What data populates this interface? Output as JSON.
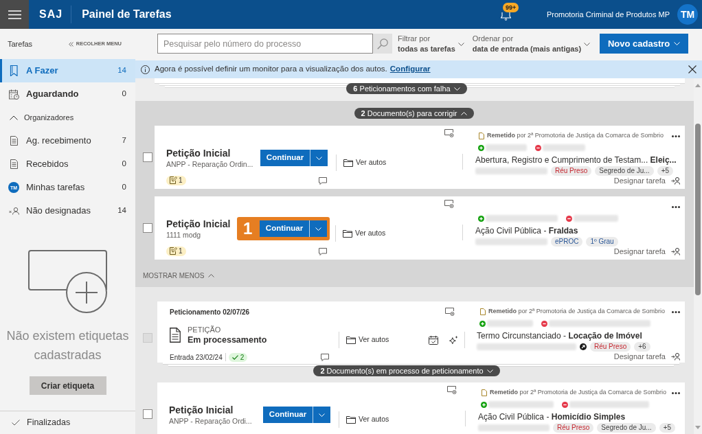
{
  "topbar": {
    "logo": "SAJ",
    "title": "Painel de Tarefas",
    "notification_count": "99+",
    "organization": "Promotoria Criminal de Produtos MP",
    "avatar_initials": "TM"
  },
  "sidebar": {
    "heading": "Tarefas",
    "collapse_label": "RECOLHER MENU",
    "items": [
      {
        "kind": "icon",
        "label": "A Fazer",
        "count": "14",
        "selected": true
      },
      {
        "kind": "icon",
        "label": "Aguardando",
        "count": "0",
        "selected": false
      }
    ],
    "organizers": {
      "label": "Organizadores",
      "expanded": true,
      "items": [
        {
          "kind": "icon",
          "label": "Ag. recebimento",
          "count": "7",
          "selected": false
        },
        {
          "kind": "icon",
          "label": "Recebidos",
          "count": "0",
          "selected": false
        },
        {
          "kind": "avatar",
          "initials": "TM",
          "label": "Minhas tarefas",
          "count": "0",
          "selected": false
        },
        {
          "kind": "icon",
          "label": "Não designadas",
          "count": "14",
          "selected": false
        }
      ]
    },
    "empty_labels": {
      "message": "Não existem etiquetas cadastradas",
      "button": "Criar etiqueta"
    },
    "footer_item": {
      "label": "Finalizadas"
    }
  },
  "toolbar": {
    "search": {
      "placeholder": "Pesquisar pelo número do processo"
    },
    "filter": {
      "label": "Filtrar por",
      "value": "todas as tarefas"
    },
    "sort": {
      "label": "Ordenar por",
      "value": "data de entrada (mais antigas)"
    },
    "new_button": "Novo cadastro"
  },
  "banner": {
    "message": "Agora é possível definir um monitor para a visualização dos autos.",
    "link": "Configurar"
  },
  "task_list": {
    "failed_group": {
      "label": "**6** Peticionamentos com falha",
      "expanded": false
    },
    "correction_group": {
      "label": "**2** Documento(s) para corrigir",
      "expanded": true,
      "collapse_label": "MOSTRAR MENOS",
      "cards": [
        {
          "kind": "task",
          "checked": false,
          "disabled": false,
          "title": "Petição Inicial",
          "subtitle": "ANPP - Reparação Ordin...",
          "action": "Continuar",
          "link": "Ver autos",
          "note_count": "1",
          "sender": "**Remetido** por 2ª Promotoria de Justiça da Comarca de Sombrio",
          "subject": "Abertura, Registro e Cumprimento de Testam... **Eleiç...**",
          "tags": [
            {
              "kind": "text",
              "label": "Réu Preso",
              "color": "#c4262e"
            },
            {
              "kind": "text",
              "label": "Segredo de Ju...",
              "color": "#424242"
            },
            {
              "kind": "text",
              "label": "+5",
              "color": "#424242"
            }
          ],
          "assign": "Designar tarefa"
        },
        {
          "kind": "task",
          "checked": false,
          "disabled": false,
          "title": "Petição Inicial",
          "subtitle": "1111 modg",
          "action": "Continuar",
          "callout": "1",
          "link": "Ver autos",
          "note_count": "1",
          "subject": "Ação Civil Pública - **Fraldas**",
          "tags": [
            {
              "kind": "text",
              "label": "ePROC",
              "color": "#2b5797"
            },
            {
              "kind": "text",
              "label": "1º Grau",
              "color": "#2b5797"
            }
          ],
          "assign": "Designar tarefa"
        }
      ]
    },
    "cards": [
      {
        "kind": "petition",
        "checked": false,
        "disabled": true,
        "header": "Peticionamento 02/07/26",
        "doc_type": "PETIÇÃO",
        "status": "Em processamento",
        "entry": "Entrada 23/02/24",
        "approved_count": "2",
        "link": "Ver autos",
        "sender": "**Remetido** por 2ª Promotoria de Justiça da Comarca de Sombrio",
        "subject": "Termo Circunstanciado - **Locação de Imóvel**",
        "tags": [
          {
            "kind": "icon"
          },
          {
            "kind": "text",
            "label": "Réu Preso",
            "color": "#c4262e"
          },
          {
            "kind": "text",
            "label": "+6",
            "color": "#424242"
          }
        ],
        "assign": "Designar tarefa",
        "stack": {
          "label": "**2** Documento(s) em processo de peticionamento",
          "expanded": false
        }
      },
      {
        "kind": "task",
        "checked": false,
        "disabled": false,
        "title": "Petição Inicial",
        "subtitle": "ANPP - Reparação Ordi...",
        "action": "Continuar",
        "link": "Ver autos",
        "sender": "**Remetido** por 2ª Promotoria de Justiça da Comarca de Sombrio",
        "subject": "Ação Civil Pública - **Homicídio Simples**",
        "tags": [
          {
            "kind": "text",
            "label": "Réu Preso",
            "color": "#c4262e"
          },
          {
            "kind": "text",
            "label": "Segredo de Ju...",
            "color": "#424242"
          },
          {
            "kind": "text",
            "label": "+5",
            "color": "#424242"
          }
        ]
      }
    ]
  }
}
